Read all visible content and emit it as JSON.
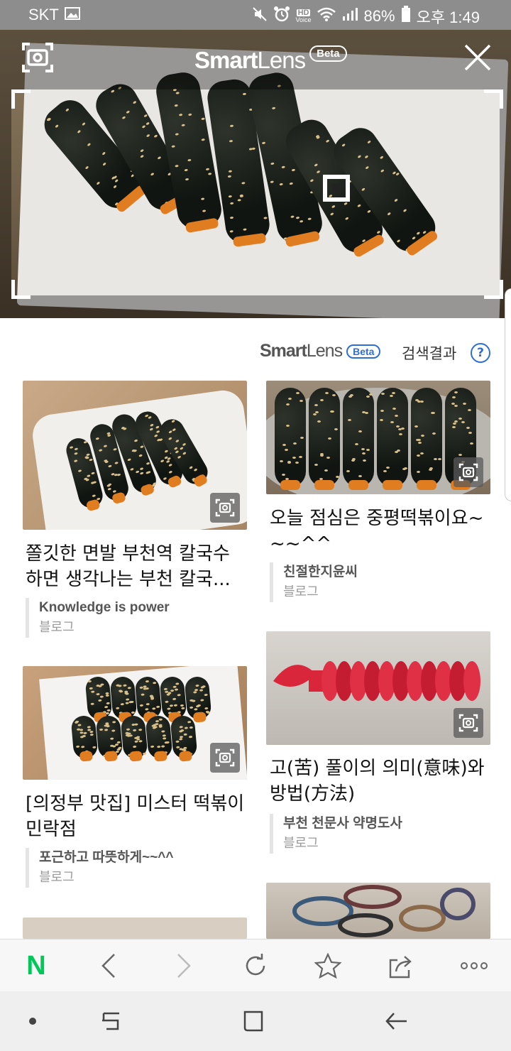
{
  "status_bar": {
    "carrier": "SKT",
    "battery": "86%",
    "time": "오후 1:49",
    "hd_voice_top": "HD",
    "hd_voice_bottom": "Voice",
    "icons": [
      "gallery-icon",
      "mute-icon",
      "alarm-icon",
      "hd-voice-icon",
      "wifi-icon",
      "signal-icon",
      "battery-icon"
    ]
  },
  "camera": {
    "brand_smart": "Smart",
    "brand_lens": "Lens",
    "beta": "Beta",
    "icons": [
      "lens-capture-icon",
      "close-icon"
    ]
  },
  "results": {
    "brand_smart": "Smart",
    "brand_lens": "Lens",
    "beta": "Beta",
    "label": "검색결과",
    "help": "?"
  },
  "cards": [
    {
      "title_1": "쫄깃한 면발 부천역 칼국수",
      "title_2": "하면 생각나는 부천 칼국...",
      "author": "Knowledge is power",
      "type": "블로그"
    },
    {
      "title_1": "오늘 점심은 중평떡볶이요~",
      "title_2": "~~^^",
      "author": "친절한지윤씨",
      "type": "블로그"
    },
    {
      "title_1": "[의정부 맛집] 미스터 떡볶이",
      "title_2": "민락점",
      "author": "포근하고 따뜻하게~~^^",
      "type": "블로그"
    },
    {
      "title_1": "고(苦) 풀이의 의미(意味)와",
      "title_2": "방법(方法)",
      "author": "부천 천문사 약명도사",
      "type": "블로그"
    }
  ],
  "toolbar": {
    "naver_logo": "N",
    "icons": [
      "naver-home-icon",
      "back-icon",
      "forward-icon",
      "refresh-icon",
      "bookmark-star-icon",
      "share-icon",
      "more-icon"
    ]
  },
  "navigation": {
    "icons": [
      "dot-icon",
      "recent-apps-icon",
      "home-icon",
      "system-back-icon"
    ]
  },
  "colors": {
    "accent_blue": "#2f6fcf",
    "naver_green": "#03c75a",
    "status_gray": "#8d8d8d"
  }
}
